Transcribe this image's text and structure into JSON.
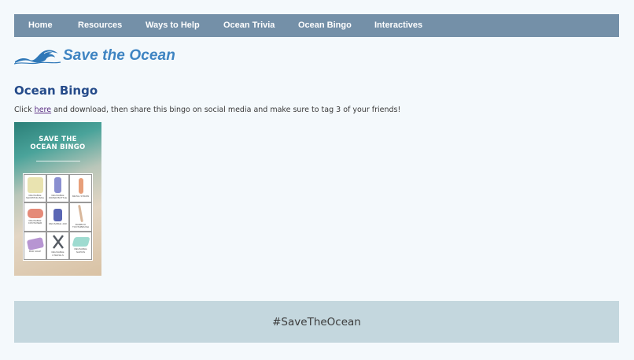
{
  "nav": {
    "items": [
      {
        "label": "Home"
      },
      {
        "label": "Resources"
      },
      {
        "label": "Ways to Help"
      },
      {
        "label": "Ocean Trivia"
      },
      {
        "label": "Ocean Bingo"
      },
      {
        "label": "Interactives"
      }
    ]
  },
  "logo": {
    "text": "Save the Ocean",
    "icon": "wave-icon"
  },
  "page": {
    "heading": "Ocean Bingo",
    "intro_before": "Click ",
    "intro_link": "here",
    "intro_after": " and download, then share this bingo on social media and make sure to tag 3 of your friends!"
  },
  "bingo": {
    "title_line1": "SAVE THE",
    "title_line2": "OCEAN BINGO",
    "cells": [
      {
        "label": "REUSABLE SHOPPING BAG",
        "color": "#e9e3b0"
      },
      {
        "label": "REUSABLE WATER BOTTLE",
        "color": "#8a8fd0"
      },
      {
        "label": "METAL STRAW",
        "color": "#e79f7a"
      },
      {
        "label": "REUSABLE CONTAINER",
        "color": "#e58a78"
      },
      {
        "label": "REUSABLE JAR",
        "color": "#5a66b4"
      },
      {
        "label": "BAMBOO TOOTHBRUSH",
        "color": "#d8b79b"
      },
      {
        "label": "BAR SOAP",
        "color": "#b795d2"
      },
      {
        "label": "REUSABLE UTENSILS",
        "color": "#555b63"
      },
      {
        "label": "REUSABLE NAPKIN",
        "color": "#9edbd0"
      }
    ]
  },
  "footer": {
    "hashtag": "#SaveTheOcean"
  }
}
